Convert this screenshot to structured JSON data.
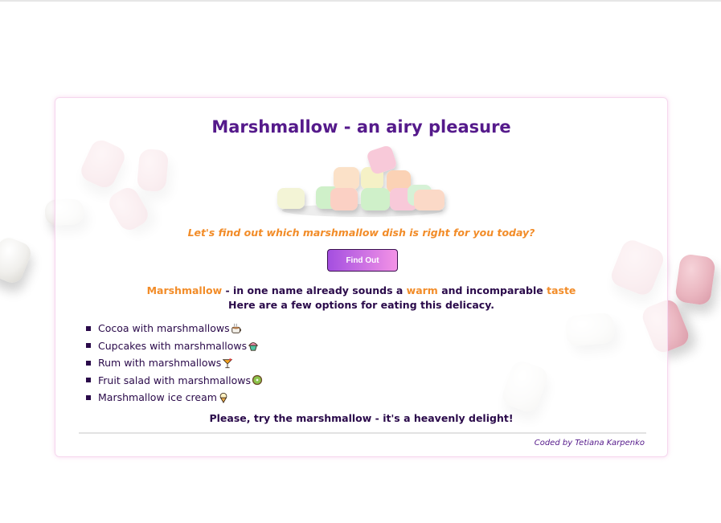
{
  "page": {
    "title": "Marshmallow - an airy pleasure",
    "tagline": "Let's find out which marshmallow dish is right for you today?",
    "button_label": "Find Out",
    "intro": {
      "word": "Marshmallow",
      "part1": " - in one name already sounds a ",
      "warm": "warm",
      "part2": " and incomparable ",
      "taste": "taste",
      "line2": "Here are a few options for eating this delicacy."
    },
    "options": [
      {
        "label": "Cocoa with marshmallows",
        "icon": "hot-cocoa-icon"
      },
      {
        "label": "Cupcakes with marshmallows",
        "icon": "cupcake-icon"
      },
      {
        "label": "Rum with marshmallows",
        "icon": "cocktail-icon"
      },
      {
        "label": "Fruit salad with marshmallows",
        "icon": "kiwi-icon"
      },
      {
        "label": "Marshmallow ice cream",
        "icon": "ice-cream-icon"
      }
    ],
    "closing": "Please, try the marshmallow - it's a heavenly delight!",
    "credit": "Coded by Tetiana Karpenko"
  },
  "colors": {
    "title": "#551a8b",
    "accent": "#f28c28",
    "text": "#2a0a4a",
    "button_start": "#a44fe0",
    "button_end": "#f392e6"
  }
}
